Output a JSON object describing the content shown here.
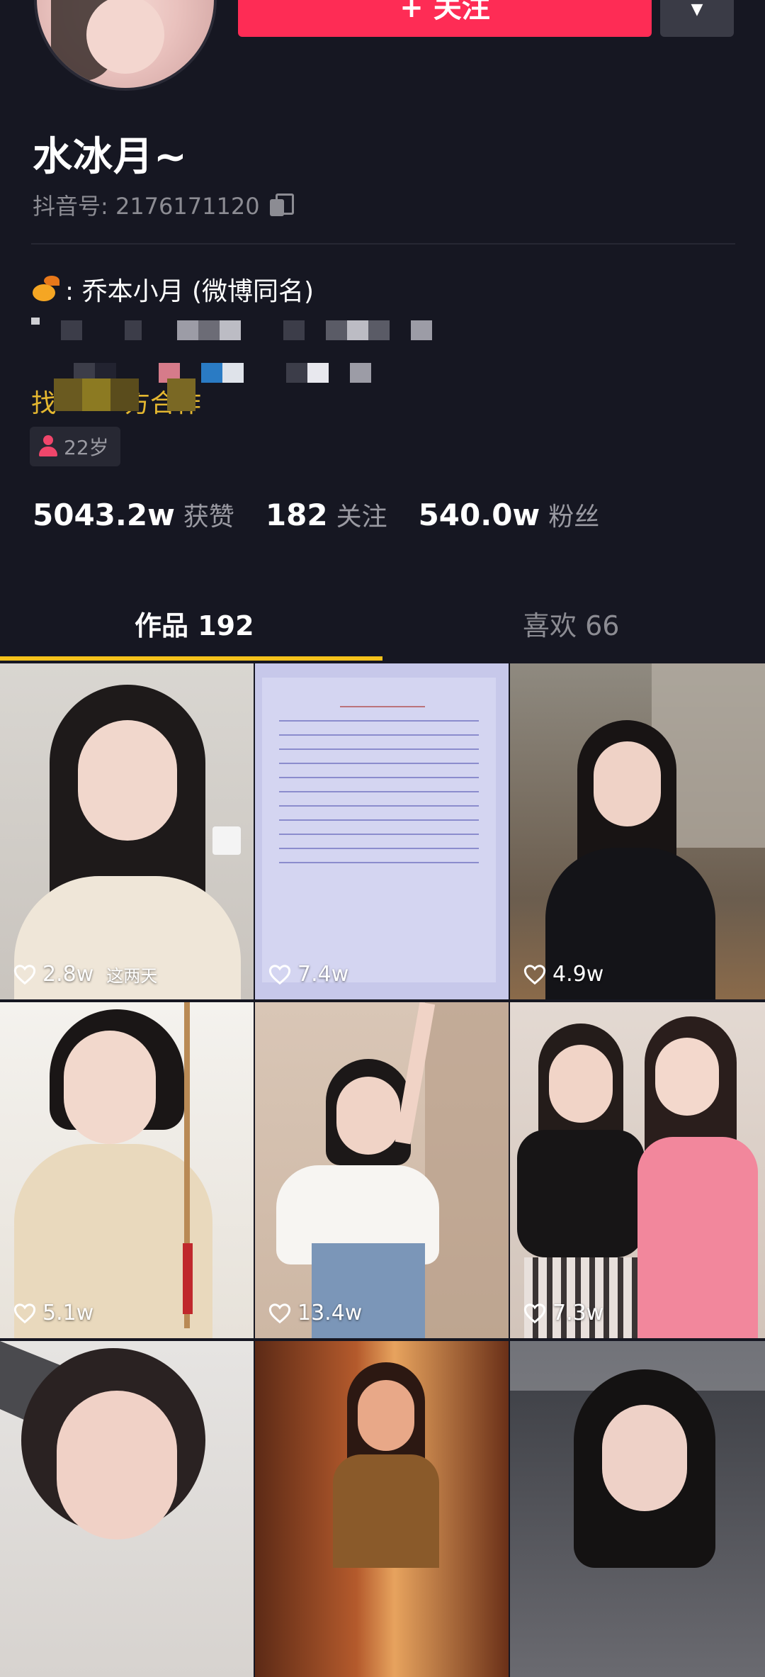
{
  "profile": {
    "name": "水冰月~",
    "douyin_id": "抖音号: 2176171120",
    "follow_label": "+ 关注",
    "more_label": "▼",
    "bio_line1": ": 乔本小月 (微博同名)",
    "bio_gold_fragment_start": "找",
    "bio_gold_fragment_end": "方合作",
    "age": "22岁"
  },
  "stats": [
    {
      "value": "5043.2w",
      "label": "获赞"
    },
    {
      "value": "182",
      "label": "关注"
    },
    {
      "value": "540.0w",
      "label": "粉丝"
    }
  ],
  "tabs": {
    "works": "作品 192",
    "likes": "喜欢 66",
    "active": "works"
  },
  "videos": [
    {
      "likes": "2.8w",
      "caption": "这两天"
    },
    {
      "likes": "7.4w",
      "caption": ""
    },
    {
      "likes": "4.9w",
      "caption": ""
    },
    {
      "likes": "5.1w",
      "caption": ""
    },
    {
      "likes": "13.4w",
      "caption": ""
    },
    {
      "likes": "7.3w",
      "caption": ""
    },
    {
      "likes": "",
      "caption": ""
    },
    {
      "likes": "",
      "caption": ""
    },
    {
      "likes": "",
      "caption": ""
    }
  ],
  "colors": {
    "background": "#161722",
    "follow_button": "#fe2c55",
    "tab_indicator": "#f4c21b",
    "gold_text": "#e4b730"
  },
  "icons": [
    "heart-icon",
    "copy-icon",
    "person-icon",
    "weibo-icon",
    "chevron-down-icon"
  ]
}
